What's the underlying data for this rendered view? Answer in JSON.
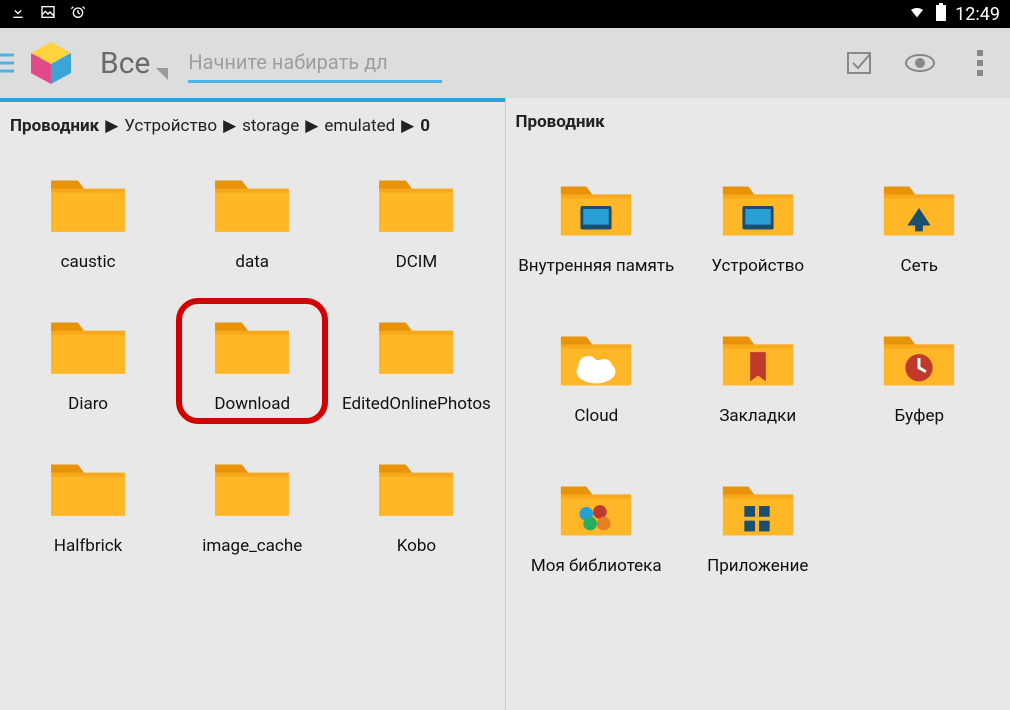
{
  "status": {
    "time": "12:49"
  },
  "toolbar": {
    "filter_label": "Все",
    "search_placeholder": "Начните набирать дл"
  },
  "left_pane": {
    "breadcrumb": [
      "Проводник",
      "Устройство",
      "storage",
      "emulated",
      "0"
    ],
    "folders": [
      {
        "name": "caustic"
      },
      {
        "name": "data"
      },
      {
        "name": "DCIM"
      },
      {
        "name": "Diaro"
      },
      {
        "name": "Download",
        "highlighted": true
      },
      {
        "name": "EditedOnlinePhotos"
      },
      {
        "name": "Halfbrick"
      },
      {
        "name": "image_cache"
      },
      {
        "name": "Kobo"
      }
    ]
  },
  "right_pane": {
    "title": "Проводник",
    "items": [
      {
        "name": "Внутренняя память",
        "icon": "internal"
      },
      {
        "name": "Устройство",
        "icon": "device"
      },
      {
        "name": "Сеть",
        "icon": "network"
      },
      {
        "name": "Cloud",
        "icon": "cloud"
      },
      {
        "name": "Закладки",
        "icon": "bookmark"
      },
      {
        "name": "Буфер",
        "icon": "clock"
      },
      {
        "name": "Моя библиотека",
        "icon": "library"
      },
      {
        "name": "Приложение",
        "icon": "apps"
      }
    ]
  }
}
